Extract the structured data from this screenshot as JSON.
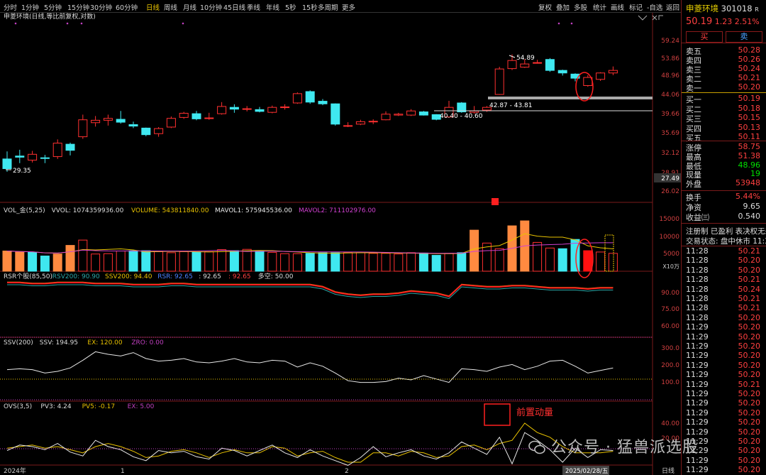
{
  "toolbar": {
    "periods": [
      "分时",
      "1分钟",
      "5分钟",
      "15分钟",
      "30分钟",
      "60分钟",
      "日线",
      "周线",
      "月线",
      "10分钟",
      "45日线",
      "季线",
      "年线",
      "5秒",
      "15秒",
      "多周期",
      "更多"
    ],
    "active_period": "日线",
    "right_items": [
      "复权",
      "叠加",
      "多股",
      "统计",
      "画线",
      "标记",
      "-自选",
      "返回"
    ]
  },
  "chart_title": "申菱环境(日线,等比前复权,对数)",
  "price_axis": [
    "59.24",
    "53.86",
    "48.96",
    "44.06",
    "39.66",
    "35.69",
    "32.12",
    "28.91",
    "26.02"
  ],
  "current_price_tag": "27.49",
  "annotations": {
    "high": "54.89",
    "low": "29.35",
    "zone1": "42.87 - 43.81",
    "zone2": "40.40 - 40.60"
  },
  "vol_header": {
    "name": "VOL_金(5,25)",
    "vvol": "VVOL: 1074359936.00",
    "volume": "VOLUME: 543811840.00",
    "mavol1": "MAVOL1: 575945536.00",
    "mavol2": "MAVOL2: 711102976.00"
  },
  "vol_axis": [
    "15000",
    "10000",
    "5000"
  ],
  "vol_unit": "X10万",
  "rsr_header": {
    "name": "RSR个股(85,50)",
    "rsv": "RSV200: 90.90",
    "ssv": "SSV200: 94.40",
    "rsr": "RSR: 92.65",
    "v1": ": 92.65",
    "v2": ": 92.65",
    "dk": "多空: 50.00"
  },
  "rsr_axis": [
    "90.00",
    "75.00",
    "60.00"
  ],
  "ssv_header": {
    "name": "SSV(200)",
    "ssv": "SSV: 194.95",
    "ex": "EX: 120.00",
    "zro": "ZRO: 0.00"
  },
  "ssv_axis": [
    "300.0",
    "200.0",
    "100.0"
  ],
  "ovs_header": {
    "name": "OVS(3,5)",
    "pv3": "PV3: 4.24",
    "pv5": "PV5: -0.17",
    "ex": "EX: 5.00"
  },
  "ovs_axis": [
    "40.00",
    "20.00"
  ],
  "ovs_note": "前置动量",
  "date_axis": {
    "d1": "2024年",
    "d2": "1",
    "d3": "2",
    "d4": "2025/02/28/五",
    "period": "日线"
  },
  "watermark": "公众号 · 猛兽派选股",
  "quote": {
    "name": "申菱环境",
    "code": "301018",
    "flag": "R",
    "price": "50.19",
    "change": "1.23",
    "pct": "2.51%",
    "buy_label": "买",
    "sell_label": "卖",
    "asks": [
      {
        "l": "卖五",
        "v": "50.28"
      },
      {
        "l": "卖四",
        "v": "50.26"
      },
      {
        "l": "卖三",
        "v": "50.24"
      },
      {
        "l": "卖二",
        "v": "50.21"
      },
      {
        "l": "卖一",
        "v": "50.20"
      }
    ],
    "bids": [
      {
        "l": "买一",
        "v": "50.19"
      },
      {
        "l": "买二",
        "v": "50.18"
      },
      {
        "l": "买三",
        "v": "50.15"
      },
      {
        "l": "买四",
        "v": "50.13"
      },
      {
        "l": "买五",
        "v": "50.11"
      }
    ],
    "stats": [
      {
        "l": "涨停",
        "v": "58.75"
      },
      {
        "l": "最高",
        "v": "51.38"
      },
      {
        "l": "最低",
        "v": "48.96"
      },
      {
        "l": "现量",
        "v": "19"
      },
      {
        "l": "外盘",
        "v": "53948"
      }
    ],
    "stats2": [
      {
        "l": "换手",
        "v": "5.44%"
      },
      {
        "l": "净资",
        "v": "9.65"
      },
      {
        "l": "收益㈢",
        "v": "0.540"
      }
    ],
    "reg": "注册制 已盈利 表决权无差",
    "status": "交易状态: 盘中休市 11:30",
    "ticks": [
      [
        "11:28",
        "50.21"
      ],
      [
        "11:28",
        "50.20"
      ],
      [
        "11:28",
        "50.20"
      ],
      [
        "11:28",
        "50.21"
      ],
      [
        "11:28",
        "50.24"
      ],
      [
        "11:28",
        "50.21"
      ],
      [
        "11:28",
        "50.21"
      ],
      [
        "11:28",
        "50.20"
      ],
      [
        "11:29",
        "50.20"
      ],
      [
        "11:29",
        "50.20"
      ],
      [
        "11:29",
        "50.20"
      ],
      [
        "11:29",
        "50.20"
      ],
      [
        "11:29",
        "50.20"
      ],
      [
        "11:29",
        "50.20"
      ],
      [
        "11:29",
        "50.21"
      ],
      [
        "11:29",
        "50.20"
      ],
      [
        "11:29",
        "50.20"
      ],
      [
        "11:29",
        "50.20"
      ],
      [
        "11:29",
        "50.20"
      ],
      [
        "11:29",
        "50.20"
      ],
      [
        "11:29",
        "50.20"
      ],
      [
        "11:29",
        "50.20"
      ],
      [
        "11:29",
        "50.20"
      ],
      [
        "11:29",
        "50.20"
      ]
    ]
  },
  "chart_data": {
    "type": "candlestick",
    "candles": [
      [
        31.0,
        29.4,
        32.3,
        28.9
      ],
      [
        31.5,
        31.3,
        32.6,
        30.3
      ],
      [
        30.8,
        31.8,
        32.4,
        30.4
      ],
      [
        31.2,
        31.1,
        31.7,
        30.3
      ],
      [
        31.4,
        33.8,
        34.5,
        31.0
      ],
      [
        33.6,
        32.5,
        33.9,
        31.6
      ],
      [
        35.0,
        38.4,
        39.5,
        34.6
      ],
      [
        37.8,
        38.3,
        39.2,
        37.0
      ],
      [
        38.3,
        38.7,
        39.5,
        37.2
      ],
      [
        38.5,
        37.9,
        40.3,
        37.6
      ],
      [
        37.4,
        37.1,
        38.0,
        36.7
      ],
      [
        36.7,
        35.4,
        36.8,
        35.1
      ],
      [
        35.6,
        36.6,
        36.9,
        35.0
      ],
      [
        36.9,
        38.7,
        39.1,
        36.7
      ],
      [
        38.9,
        39.8,
        40.1,
        38.6
      ],
      [
        39.7,
        38.6,
        40.3,
        38.3
      ],
      [
        38.7,
        38.8,
        39.9,
        38.4
      ],
      [
        39.7,
        41.3,
        42.3,
        39.5
      ],
      [
        41.1,
        40.7,
        41.8,
        39.9
      ],
      [
        40.8,
        40.8,
        41.4,
        40.2
      ],
      [
        40.6,
        40.2,
        41.2,
        40.0
      ],
      [
        40.0,
        41.1,
        41.5,
        39.8
      ],
      [
        41.1,
        41.2,
        41.8,
        40.6
      ],
      [
        42.1,
        44.3,
        44.6,
        41.9
      ],
      [
        44.8,
        42.3,
        45.1,
        41.9
      ],
      [
        42.5,
        41.9,
        43.0,
        41.6
      ],
      [
        41.9,
        37.5,
        42.0,
        37.2
      ],
      [
        37.2,
        37.2,
        37.9,
        36.9
      ],
      [
        37.5,
        38.0,
        38.4,
        37.3
      ],
      [
        38.1,
        38.1,
        38.5,
        37.5
      ],
      [
        38.4,
        39.6,
        40.2,
        38.3
      ],
      [
        39.4,
        39.6,
        39.9,
        39.2
      ],
      [
        39.4,
        40.3,
        40.7,
        39.2
      ],
      [
        40.1,
        39.4,
        40.3,
        39.3
      ],
      [
        39.5,
        38.5,
        39.6,
        38.3
      ],
      [
        39.0,
        41.1,
        42.6,
        38.9
      ],
      [
        42.1,
        40.1,
        42.3,
        39.9
      ],
      [
        40.0,
        40.3,
        41.4,
        39.7
      ],
      [
        40.5,
        41.1,
        41.4,
        40.1
      ],
      [
        44.1,
        50.7,
        51.3,
        44.0
      ],
      [
        50.8,
        53.1,
        54.9,
        50.4
      ],
      [
        51.2,
        52.1,
        53.5,
        51.0
      ],
      [
        52.5,
        52.5,
        53.3,
        52.2
      ],
      [
        53.4,
        50.3,
        53.8,
        49.9
      ],
      [
        50.3,
        49.6,
        50.5,
        48.9
      ],
      [
        49.3,
        48.2,
        49.5,
        47.4
      ],
      [
        46.3,
        48.4,
        49.0,
        46.0
      ],
      [
        47.9,
        49.6,
        49.8,
        47.5
      ],
      [
        49.6,
        50.3,
        51.4,
        49.0
      ]
    ],
    "vol": [
      6100,
      5800,
      5700,
      4600,
      5200,
      7800,
      9400,
      5200,
      5300,
      6100,
      6200,
      6200,
      5900,
      5600,
      5900,
      5700,
      5900,
      6500,
      6200,
      6600,
      6100,
      5700,
      5300,
      5300,
      5400,
      5600,
      5600,
      5700,
      5600,
      5400,
      5400,
      5200,
      5600,
      5500,
      4800,
      5400,
      5600,
      12400,
      8500,
      6800,
      13700,
      15200,
      8700,
      7000,
      6800,
      9600,
      6200,
      5800,
      5400
    ],
    "vol_up": [
      1,
      0,
      0,
      0,
      1,
      1,
      1,
      1,
      1,
      1,
      0,
      0,
      1,
      1,
      1,
      0,
      1,
      1,
      0,
      1,
      0,
      1,
      1,
      1,
      0,
      0,
      0,
      1,
      1,
      1,
      1,
      1,
      1,
      0,
      0,
      1,
      0,
      1,
      1,
      1,
      1,
      1,
      1,
      1,
      0,
      0,
      1,
      1,
      1
    ],
    "vol_color_override": {
      "0": "orange",
      "1": "orange",
      "4": "orange",
      "5": "orange",
      "37": "orange",
      "40": "orange",
      "41": "orange",
      "46": "red"
    }
  }
}
